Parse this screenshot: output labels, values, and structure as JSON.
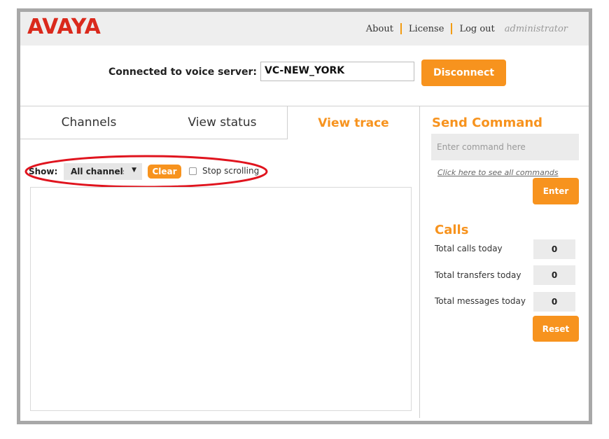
{
  "header": {
    "logo": "AVAYA",
    "nav": {
      "about": "About",
      "license": "License",
      "logout": "Log out",
      "user": "administrator"
    },
    "separator_color": "#f7931e"
  },
  "connection": {
    "label": "Connected to voice server:",
    "server": "VC-NEW_YORK",
    "disconnect_label": "Disconnect"
  },
  "tabs": [
    {
      "label": "Channels",
      "active": false
    },
    {
      "label": "View status",
      "active": false
    },
    {
      "label": "View trace",
      "active": true
    }
  ],
  "trace": {
    "show_label": "Show:",
    "channel_filter": "All channels",
    "clear_label": "Clear",
    "stop_scrolling_label": "Stop scrolling",
    "stop_scrolling_checked": false
  },
  "send_command": {
    "title": "Send Command",
    "placeholder": "Enter command here",
    "all_commands_link": "Click here to see all commands",
    "enter_label": "Enter"
  },
  "calls": {
    "title": "Calls",
    "stats": [
      {
        "label": "Total calls today",
        "value": "0"
      },
      {
        "label": "Total transfers today",
        "value": "0"
      },
      {
        "label": "Total messages today",
        "value": "0"
      }
    ],
    "reset_label": "Reset"
  },
  "colors": {
    "accent": "#f7931e",
    "brand": "#da291c",
    "highlight": "#e0141e"
  }
}
